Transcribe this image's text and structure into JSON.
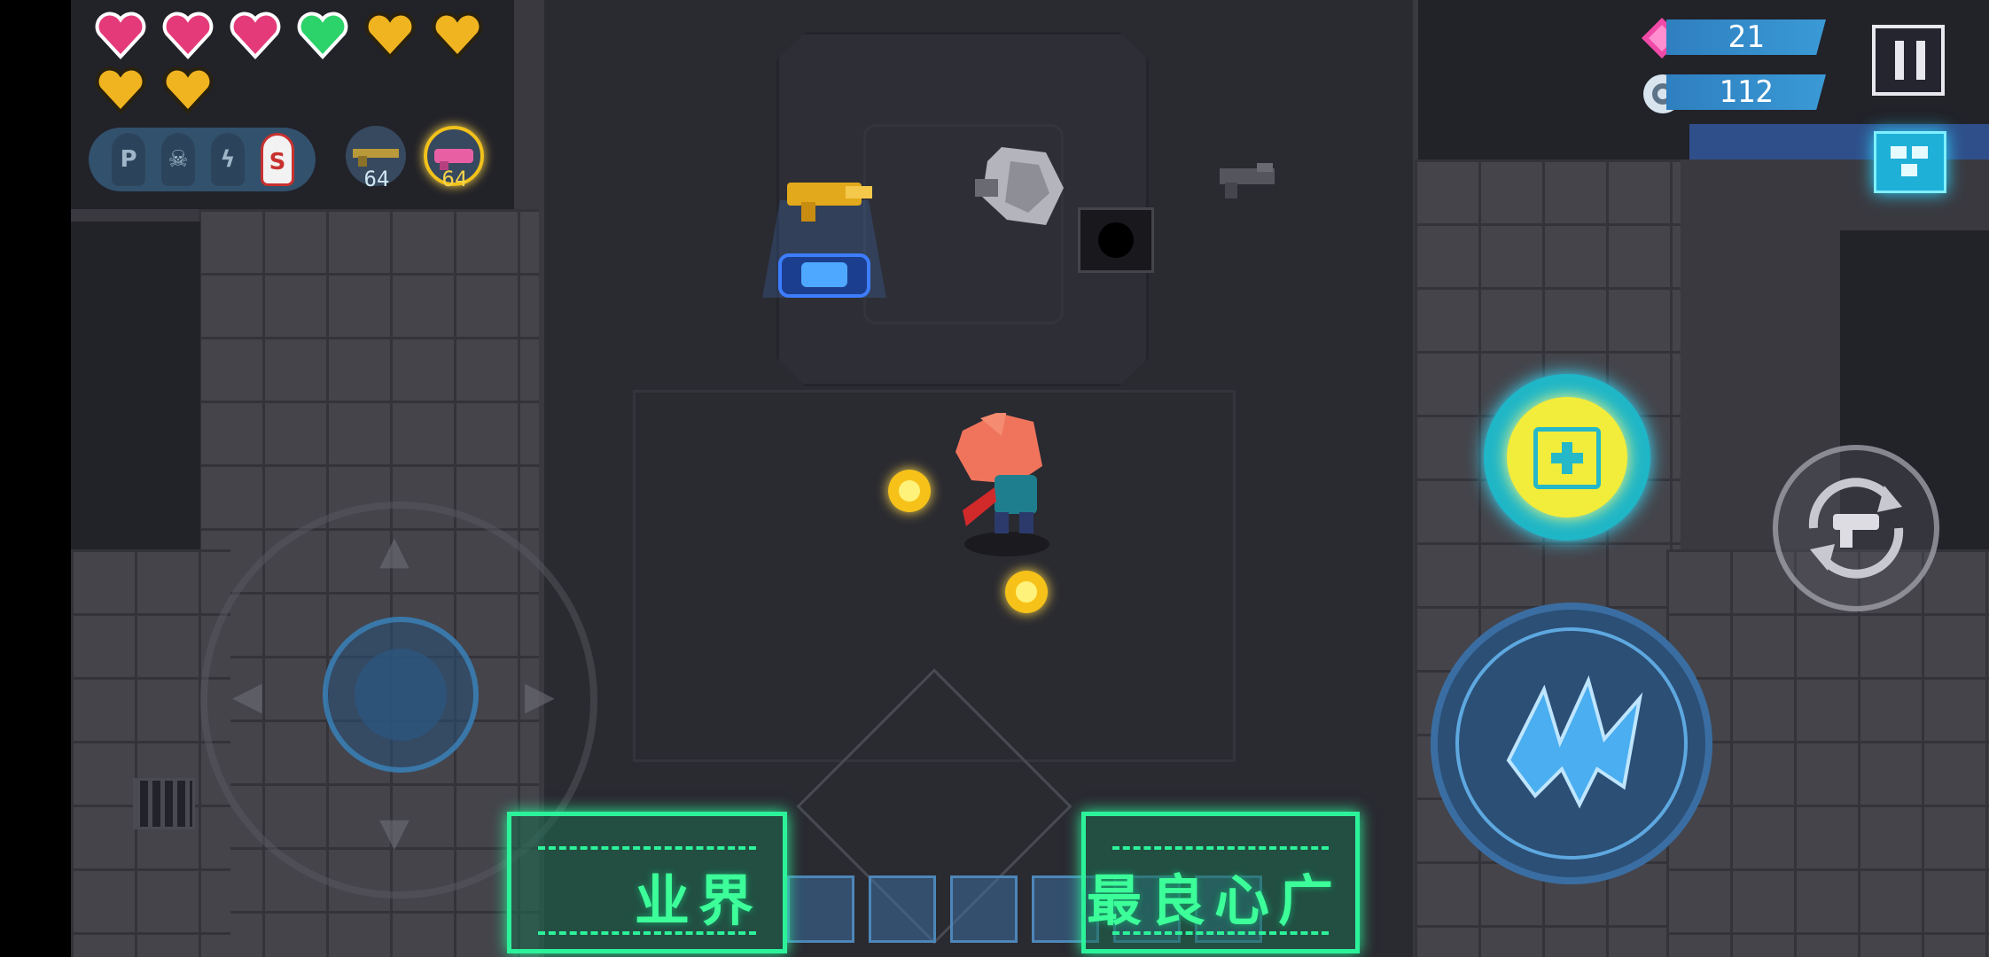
{
  "hud": {
    "hearts": [
      {
        "type": "pink-heart-icon",
        "color": "#e43a7a"
      },
      {
        "type": "pink-heart-icon",
        "color": "#e43a7a"
      },
      {
        "type": "pink-heart-icon",
        "color": "#e43a7a"
      },
      {
        "type": "green-heart-icon",
        "color": "#2cd36a"
      },
      {
        "type": "gold-shield-heart-icon",
        "color": "#f0b420"
      },
      {
        "type": "gold-shield-heart-icon",
        "color": "#f0b420"
      },
      {
        "type": "gold-shield-heart-icon",
        "color": "#f0b420"
      },
      {
        "type": "gold-shield-heart-icon",
        "color": "#f0b420"
      }
    ],
    "ammo_types": [
      {
        "label": "P",
        "active": false
      },
      {
        "label": "☠",
        "active": false
      },
      {
        "label": "ϟ",
        "active": false
      },
      {
        "label": "S",
        "active": true
      }
    ],
    "weapons": [
      {
        "name": "rifle-icon",
        "count": "64",
        "selected": false
      },
      {
        "name": "pink-blaster-icon",
        "count": "64",
        "selected": true
      }
    ],
    "gems": "21",
    "energy": "112",
    "pause_icon": "pause-icon",
    "minimap_icon": "minimap-icon"
  },
  "controls": {
    "joystick": "virtual-joystick",
    "skill_icon": "crosshair-skill-icon",
    "swap_icon": "swap-weapon-icon",
    "attack_icon": "claw-attack-icon"
  },
  "overlay": {
    "left_banner": "业界",
    "right_banner": "最良心广",
    "accent": "#2cf29a"
  },
  "colors": {
    "brand_cyan": "#1fb6c7",
    "skill_yellow": "#f2ec3a",
    "ui_blue": "#2f7fbf",
    "coin": "#f6c219"
  }
}
